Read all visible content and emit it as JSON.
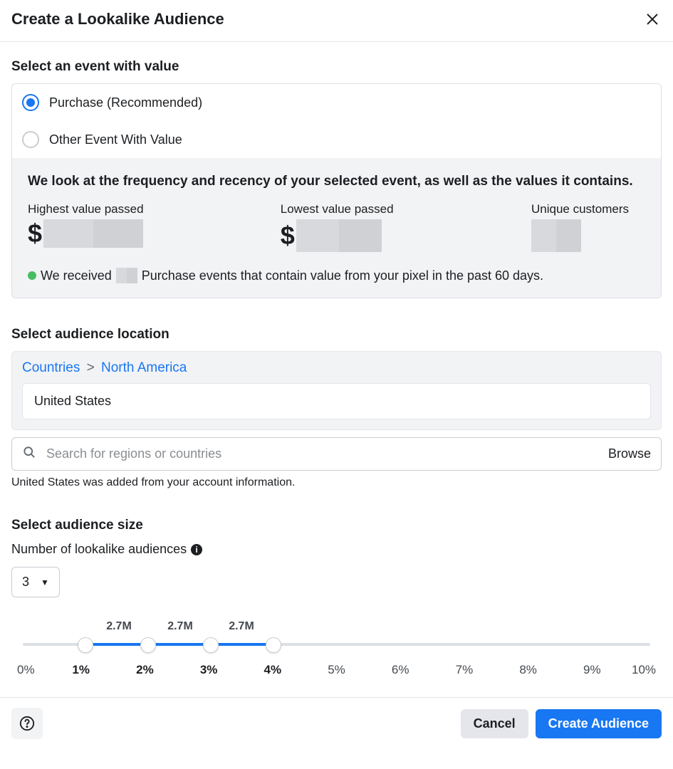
{
  "header": {
    "title": "Create a Lookalike Audience"
  },
  "event_section": {
    "title": "Select an event with value",
    "options": {
      "purchase": "Purchase (Recommended)",
      "other": "Other Event With Value"
    },
    "stats_headline": "We look at the frequency and recency of your selected event, as well as the values it contains.",
    "highest_label": "Highest value passed",
    "lowest_label": "Lowest value passed",
    "unique_label": "Unique customers",
    "dollar": "$",
    "received_prefix": "We received",
    "received_suffix": "Purchase events that contain value from your pixel in the past 60 days."
  },
  "location_section": {
    "title": "Select audience location",
    "breadcrumb_countries": "Countries",
    "breadcrumb_region": "North America",
    "breadcrumb_sep": ">",
    "selected_location": "United States",
    "search_placeholder": "Search for regions or countries",
    "browse": "Browse",
    "helper": "United States was added from your account information."
  },
  "size_section": {
    "title": "Select audience size",
    "num_label": "Number of lookalike audiences",
    "num_value": "3",
    "sizes": [
      "2.7M",
      "2.7M",
      "2.7M"
    ],
    "ticks": [
      "0%",
      "1%",
      "2%",
      "3%",
      "4%",
      "5%",
      "6%",
      "7%",
      "8%",
      "9%",
      "10%"
    ]
  },
  "footer": {
    "cancel": "Cancel",
    "create": "Create Audience"
  }
}
